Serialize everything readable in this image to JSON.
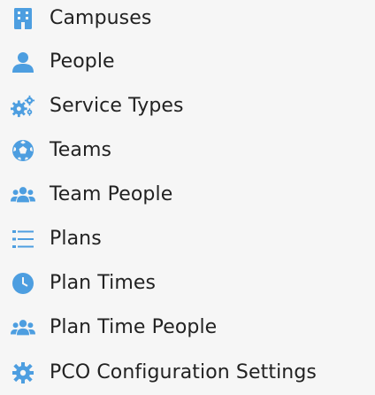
{
  "colors": {
    "icon": "#4d9ee0",
    "text": "#222222",
    "background": "#f6f6f6"
  },
  "menu": {
    "items": [
      {
        "label": "Campuses",
        "icon": "building-icon"
      },
      {
        "label": "People",
        "icon": "person-icon"
      },
      {
        "label": "Service Types",
        "icon": "cogs-icon"
      },
      {
        "label": "Teams",
        "icon": "soccer-ball-icon"
      },
      {
        "label": "Team People",
        "icon": "users-icon"
      },
      {
        "label": "Plans",
        "icon": "list-icon"
      },
      {
        "label": "Plan Times",
        "icon": "clock-icon"
      },
      {
        "label": "Plan Time People",
        "icon": "users-icon"
      },
      {
        "label": "PCO Configuration Settings",
        "icon": "gear-icon"
      }
    ]
  }
}
